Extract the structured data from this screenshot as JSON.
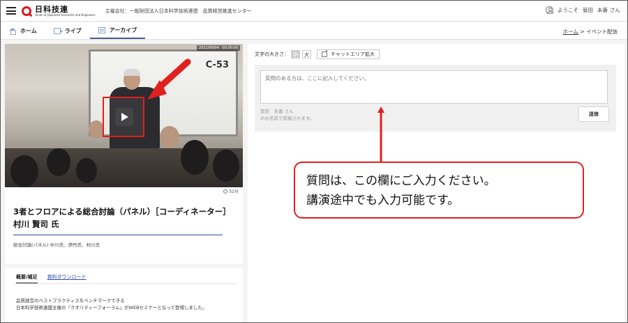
{
  "header": {
    "logo_text": "日科技連",
    "logo_sub": "Union of Japanese Scientists and Engineers",
    "organizer": "主催会社：一般財団法人日本科学技術連盟　品質経営推進センター",
    "greeting": "ようこそ",
    "user_last": "管田",
    "user_first": "未番",
    "honorific": "さん"
  },
  "nav": {
    "tabs": [
      {
        "label": "ホーム",
        "icon": "home-icon"
      },
      {
        "label": "ライブ",
        "icon": "live-icon"
      },
      {
        "label": "アーカイブ",
        "icon": "archive-icon"
      }
    ],
    "breadcrumb_home": "ホーム",
    "breadcrumb_sep": ">",
    "breadcrumb_current": "イベント配信"
  },
  "video": {
    "whiteboard_label": "C-53",
    "stamp": "2021/09/04 · 00:00:00",
    "duration": "52分"
  },
  "talk": {
    "title": "3者とフロアによる総合討論（パネル）［コーディネーター］村川 賢司 氏",
    "speakers": "総合討論(パネル) 中川氏、伊丹氏、村川氏"
  },
  "sub_tabs": {
    "overview": "概要/補足",
    "download": "資料ダウンロード"
  },
  "description": {
    "line1": "品質経営のベストプラクティスをベンチマークできる",
    "line2": "日本科学技術連盟主催の「クオリティーフォーラム」がWEBセミナーとなって登場しました。"
  },
  "chat": {
    "font_size_label": "文字の大きさ：",
    "font_mid": "中",
    "font_large": "大",
    "expand_label": "チャットエリア拡大",
    "placeholder": "質問のある方は、ここに記入してください。",
    "poster_name": "管田　未番 さん",
    "poster_note": "のお名前で投稿されます。",
    "send_label": "送信"
  },
  "callout": {
    "line1": "質問は、この欄にご入力ください。",
    "line2": "講演途中でも入力可能です。"
  },
  "colors": {
    "accent_red": "#e0201c",
    "nav_active": "#4a5a8a",
    "link_blue": "#2a4fae"
  }
}
